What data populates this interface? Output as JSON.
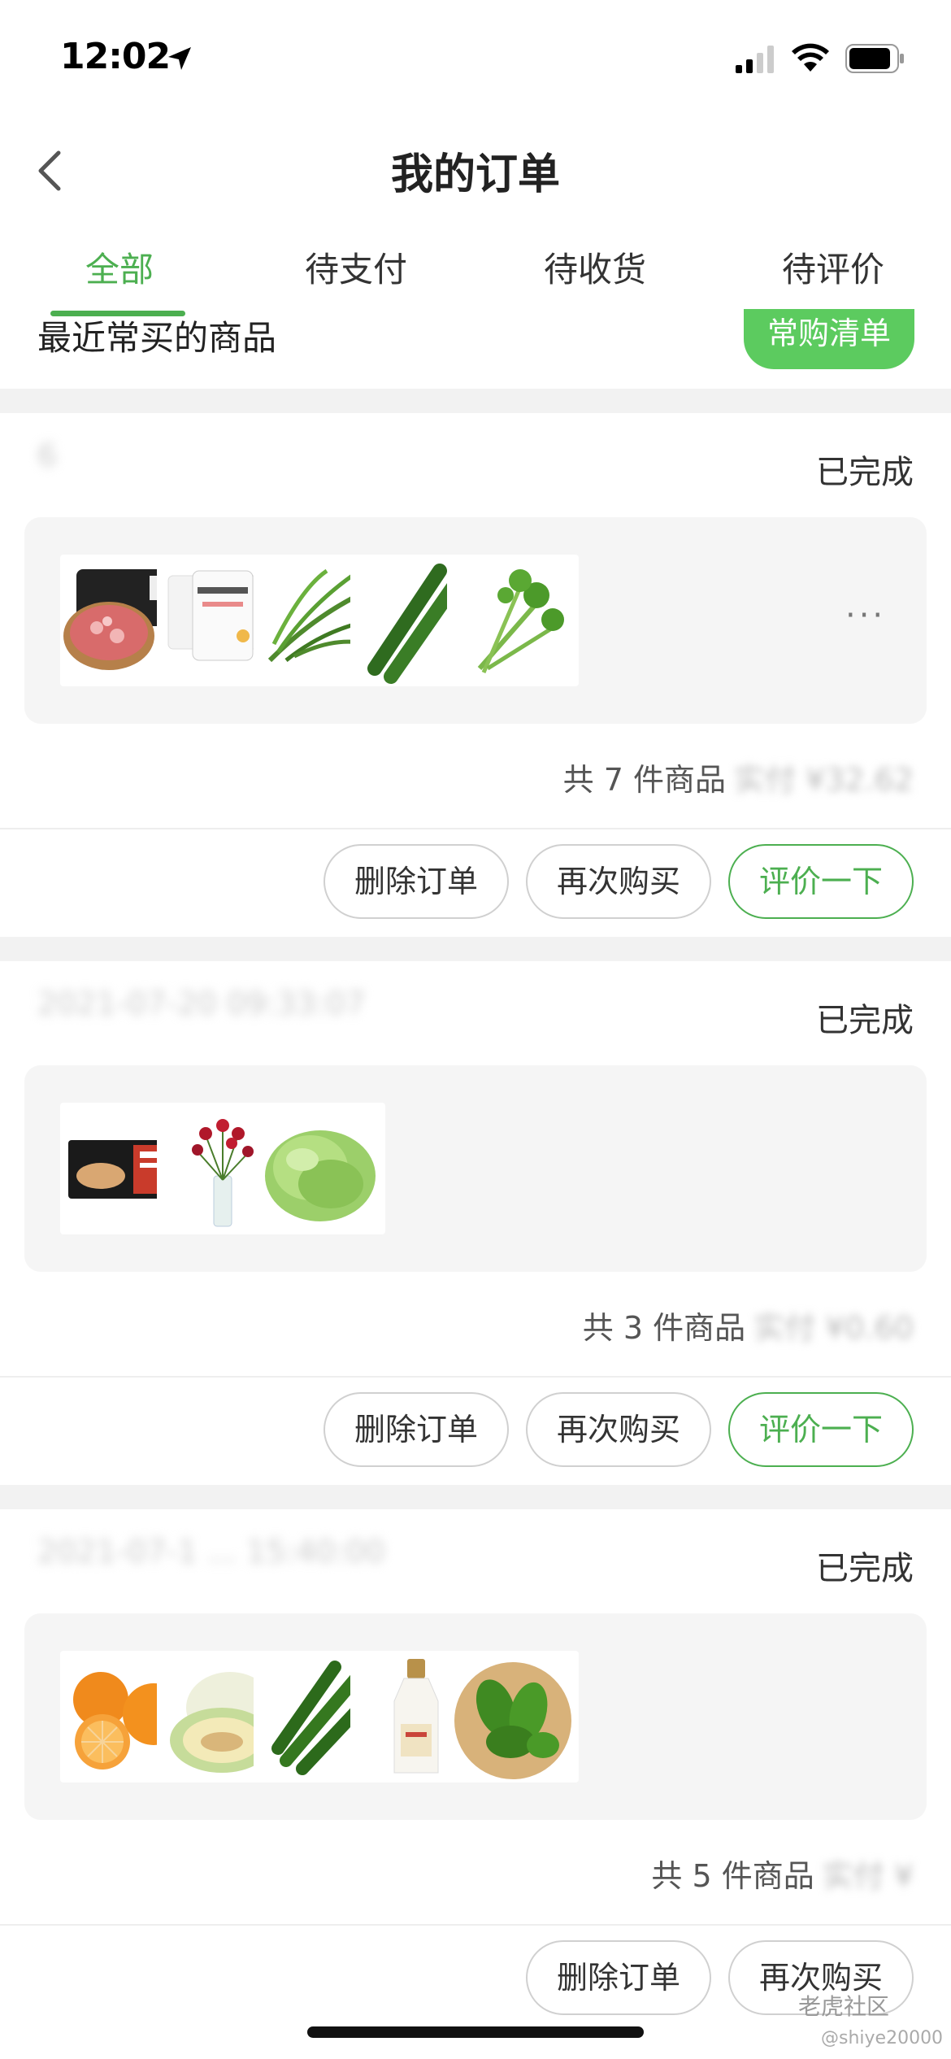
{
  "status_bar": {
    "time": "12:02"
  },
  "nav": {
    "title": "我的订单"
  },
  "tabs": [
    "全部",
    "待支付",
    "待收货",
    "待评价"
  ],
  "recent": {
    "title": "最近常买的商品",
    "button": "常购清单"
  },
  "orders": [
    {
      "id": "6",
      "status": "已完成",
      "items": [
        "pork-mince",
        "yogurt-cups",
        "water-spinach",
        "cucumber",
        "celery"
      ],
      "has_more": true,
      "more": "···",
      "summary": "共 7 件商品",
      "price": "实付 ¥32.62",
      "buttons": [
        "删除订单",
        "再次购买",
        "评价一下"
      ]
    },
    {
      "id": "2021-07-20 09:33:07",
      "status": "已完成",
      "items": [
        "dumplings-pack",
        "roses",
        "lettuce"
      ],
      "has_more": false,
      "summary": "共 3 件商品",
      "price": "实付 ¥0.60",
      "buttons": [
        "删除订单",
        "再次购买",
        "评价一下"
      ]
    },
    {
      "id": "2021-07-1 ... 15:40:00",
      "status": "已完成",
      "items": [
        "oranges",
        "melon",
        "cucumbers",
        "milk-bottle",
        "green-peppers"
      ],
      "has_more": false,
      "summary": "共 5 件商品",
      "price": "实付 ¥",
      "buttons": [
        "删除订单",
        "再次购买"
      ]
    }
  ],
  "watermark": "老虎社区",
  "watermark_user": "@shiye20000",
  "colors": {
    "accent": "#4caf50",
    "button_fill": "#5ccb5f",
    "gap": "#f2f2f2"
  }
}
